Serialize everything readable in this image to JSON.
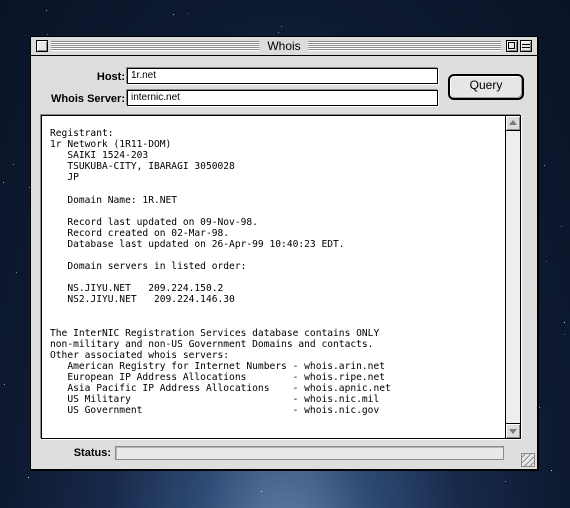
{
  "window": {
    "title": "Whois"
  },
  "form": {
    "host_label": "Host:",
    "host_value": "1r.net",
    "server_label": "Whois Server:",
    "server_value": "internic.net",
    "query_label": "Query"
  },
  "result": {
    "lines": [
      "Registrant:",
      "1r Network (1R11-DOM)",
      "   SAIKI 1524-203",
      "   TSUKUBA-CITY, IBARAGI 3050028",
      "   JP",
      "",
      "   Domain Name: 1R.NET",
      "",
      "   Record last updated on 09-Nov-98.",
      "   Record created on 02-Mar-98.",
      "   Database last updated on 26-Apr-99 10:40:23 EDT.",
      "",
      "   Domain servers in listed order:",
      "",
      "   NS.JIYU.NET   209.224.150.2",
      "   NS2.JIYU.NET   209.224.146.30",
      "",
      "",
      "The InterNIC Registration Services database contains ONLY",
      "non-military and non-US Government Domains and contacts.",
      "Other associated whois servers:",
      "   American Registry for Internet Numbers - whois.arin.net",
      "   European IP Address Allocations        - whois.ripe.net",
      "   Asia Pacific IP Address Allocations    - whois.apnic.net",
      "   US Military                            - whois.nic.mil",
      "   US Government                          - whois.nic.gov"
    ]
  },
  "status": {
    "label": "Status:",
    "value": ""
  },
  "icons": {
    "close": "close-box-icon",
    "zoom": "zoom-box-icon",
    "collapse": "collapse-box-icon",
    "scroll_up": "scroll-up-arrow-icon",
    "scroll_down": "scroll-down-arrow-icon",
    "resize": "resize-grip-icon"
  }
}
